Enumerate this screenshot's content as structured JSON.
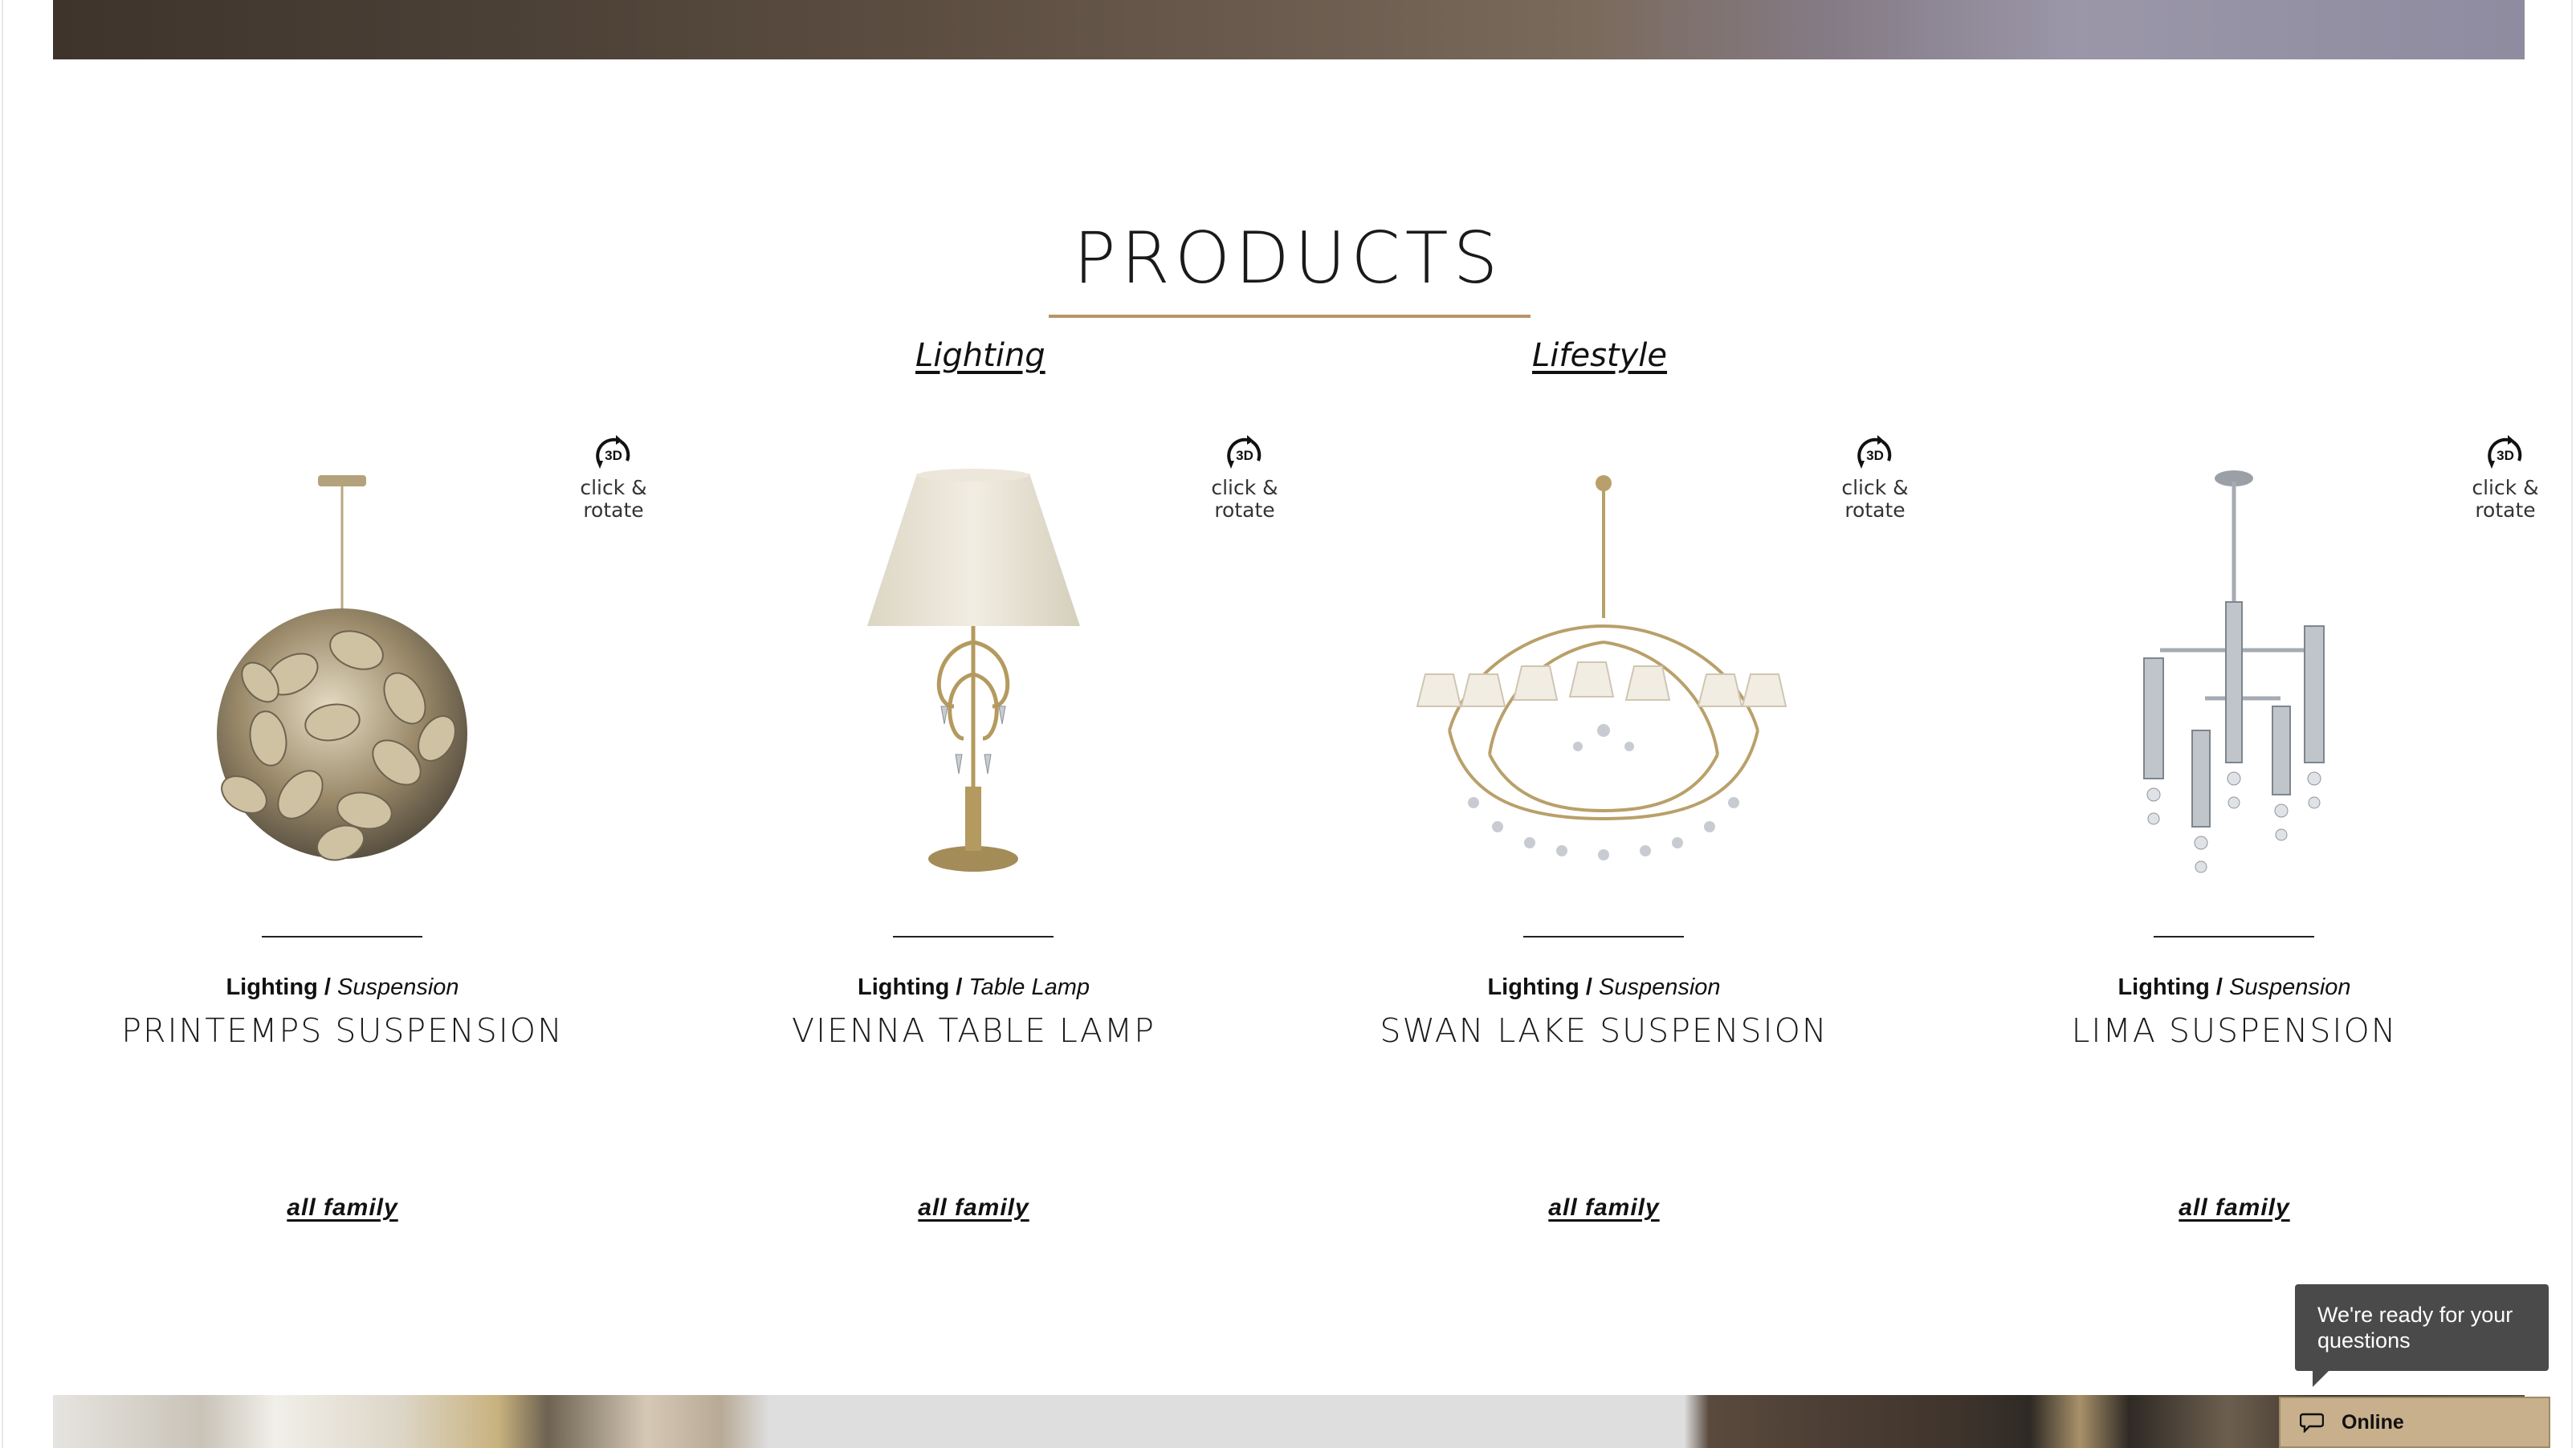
{
  "section_title": "PRODUCTS",
  "categories": [
    {
      "label": "Lighting"
    },
    {
      "label": "Lifestyle"
    }
  ],
  "rotate_badge": {
    "icon_text": "3D",
    "line1": "click &",
    "line2": "rotate"
  },
  "products": [
    {
      "category": "Lighting /",
      "subcategory": "Suspension",
      "name": "PRINTEMPS SUSPENSION",
      "link": "all family",
      "icon": "printemps-suspension-image"
    },
    {
      "category": "Lighting /",
      "subcategory": "Table Lamp",
      "name": "VIENNA TABLE LAMP",
      "link": "all family",
      "icon": "vienna-table-lamp-image"
    },
    {
      "category": "Lighting /",
      "subcategory": "Suspension",
      "name": "SWAN LAKE SUSPENSION",
      "link": "all family",
      "icon": "swan-lake-suspension-image"
    },
    {
      "category": "Lighting /",
      "subcategory": "Suspension",
      "name": "LIMA SUSPENSION",
      "link": "all family",
      "icon": "lima-suspension-image"
    }
  ],
  "chat": {
    "bubble_text": "We're ready for your questions",
    "status": "Online",
    "icon": "chat-icon"
  },
  "colors": {
    "accent": "#b8956a",
    "chat_bg": "#4a4a4a",
    "chat_tab": "#c8b08c"
  }
}
